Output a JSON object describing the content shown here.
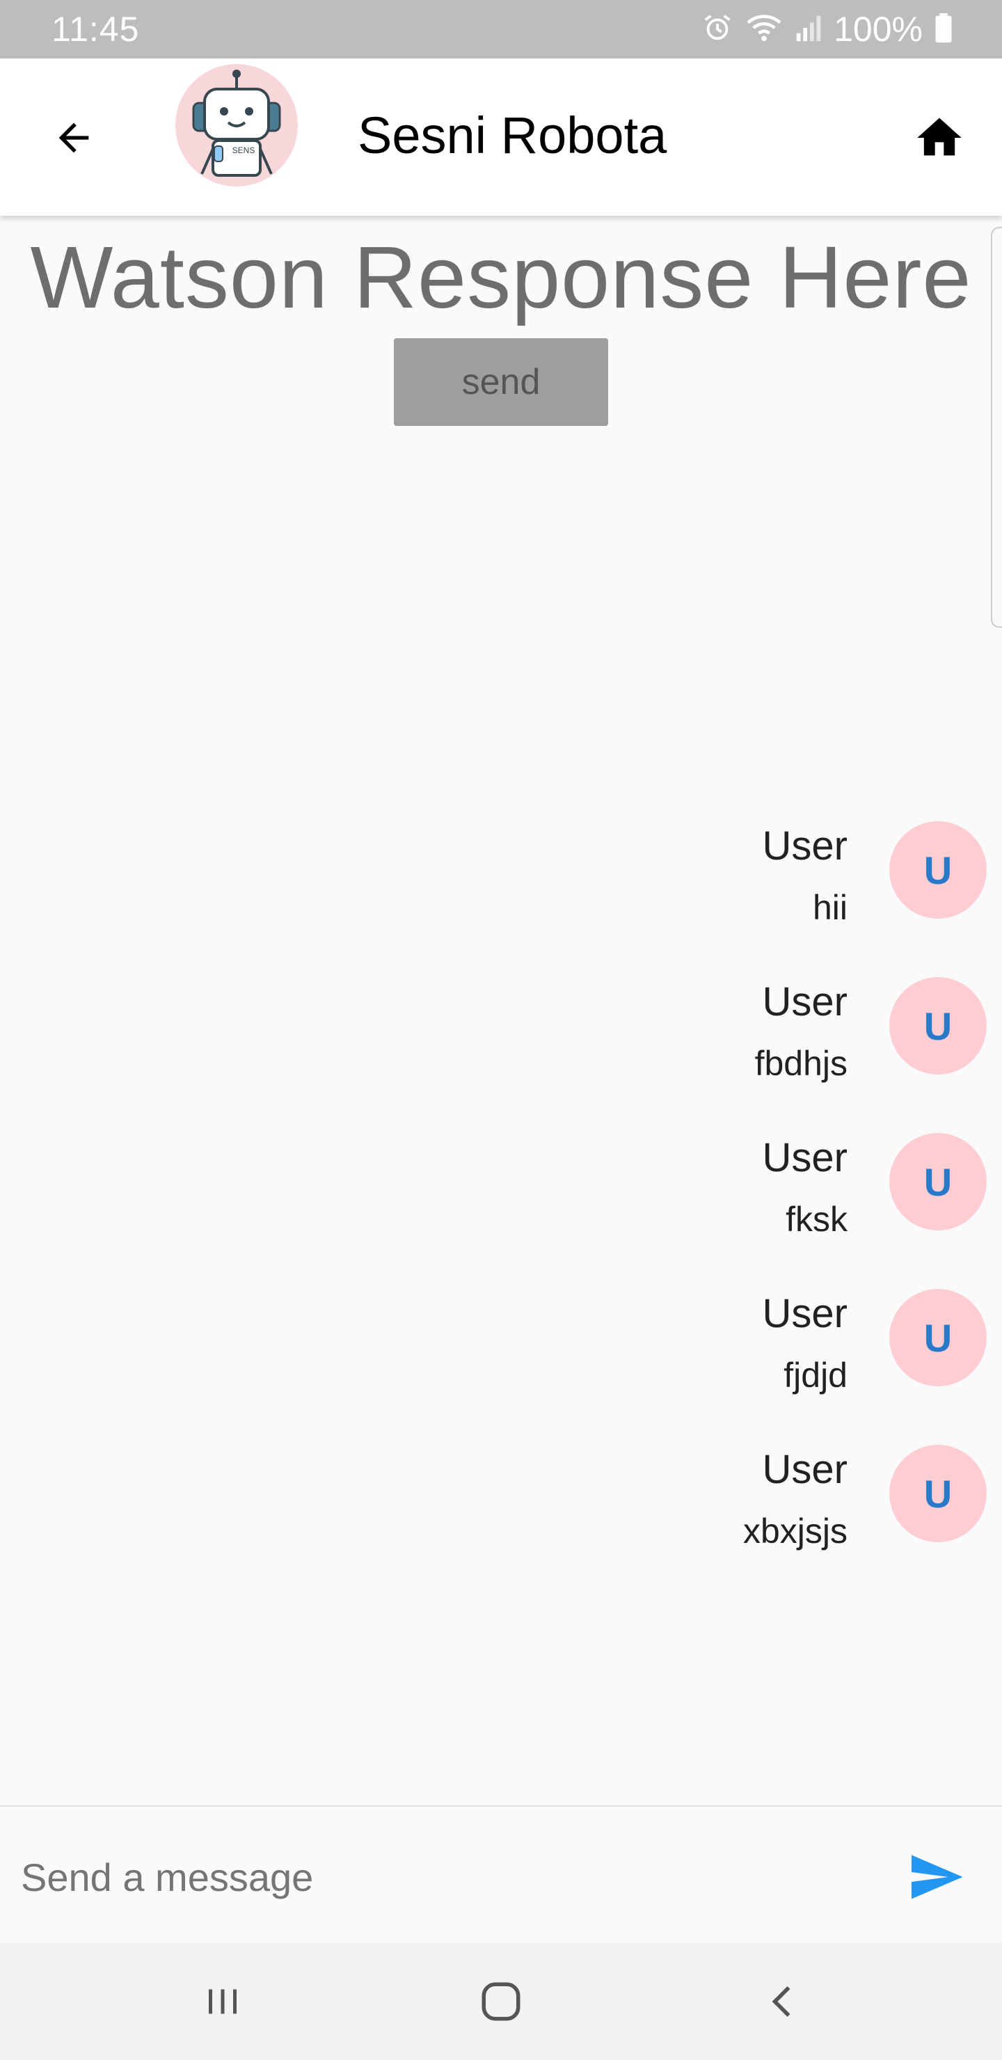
{
  "status_bar": {
    "time": "11:45",
    "battery_percent": "100%",
    "icons": [
      "alarm-icon",
      "wifi-icon",
      "signal-icon",
      "battery-icon"
    ]
  },
  "app_bar": {
    "back_icon": "arrow-back-icon",
    "logo_icon": "robot-avatar-icon",
    "logo_text": "SENS",
    "title": "Sesni Robota",
    "home_icon": "home-icon"
  },
  "main": {
    "response_text": "Watson Response Here",
    "send_button_label": "send"
  },
  "messages": [
    {
      "sender": "User",
      "text": "hii",
      "avatar_letter": "U"
    },
    {
      "sender": "User",
      "text": "fbdhjs",
      "avatar_letter": "U"
    },
    {
      "sender": "User",
      "text": "fksk",
      "avatar_letter": "U"
    },
    {
      "sender": "User",
      "text": "fjdjd",
      "avatar_letter": "U"
    },
    {
      "sender": "User",
      "text": "xbxjsjs",
      "avatar_letter": "U"
    }
  ],
  "composer": {
    "placeholder": "Send a message",
    "value": "",
    "send_icon": "send-icon"
  },
  "colors": {
    "status_bar_bg": "#bdbdbd",
    "avatar_bg": "#ffcdd2",
    "avatar_text": "#2979c9",
    "send_icon": "#2196f3",
    "send_button_bg": "#9e9e9e"
  },
  "system_nav": {
    "icons": [
      "recent-apps-icon",
      "home-circle-icon",
      "back-chevron-icon"
    ]
  }
}
